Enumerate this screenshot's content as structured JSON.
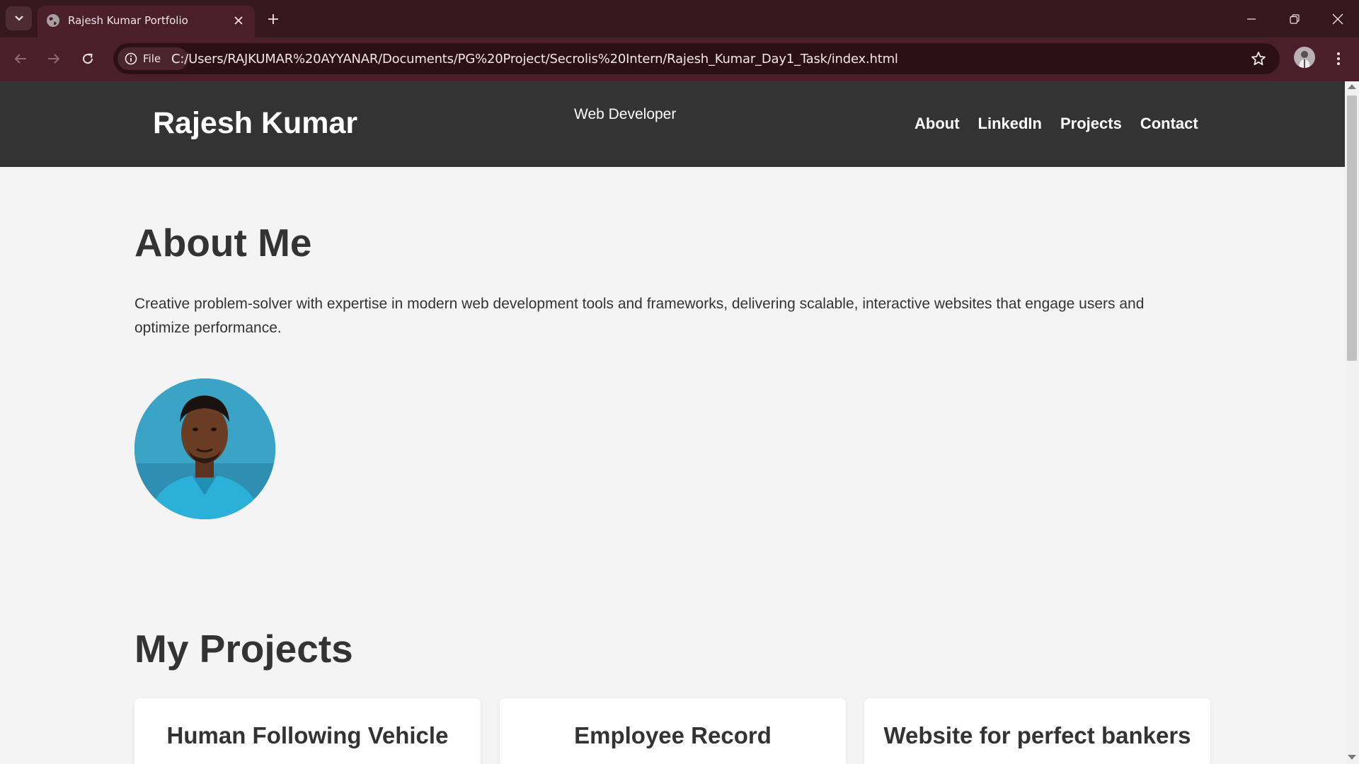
{
  "browser": {
    "tab": {
      "title": "Rajesh Kumar Portfolio"
    },
    "site_chip_label": "File",
    "url": "C:/Users/RAJKUMAR%20AYYANAR/Documents/PG%20Project/Secrolis%20Intern/Rajesh_Kumar_Day1_Task/index.html",
    "icons": [
      "tab-list-icon",
      "globe-icon",
      "close-icon",
      "plus-icon",
      "minimize-icon",
      "restore-icon",
      "window-close-icon",
      "back-arrow-icon",
      "forward-arrow-icon",
      "reload-icon",
      "info-icon",
      "star-icon",
      "profile-avatar",
      "kebab-menu-icon"
    ]
  },
  "header": {
    "name": "Rajesh Kumar",
    "role": "Web Developer",
    "nav": [
      "About",
      "LinkedIn",
      "Projects",
      "Contact"
    ]
  },
  "about": {
    "title": "About Me",
    "text": "Creative problem-solver with expertise in modern web development tools and frameworks, delivering scalable, interactive websites that engage users and optimize performance."
  },
  "projects": {
    "title": "My Projects",
    "cards": [
      "Human Following Vehicle",
      "Employee Record",
      "Website for perfect bankers"
    ]
  },
  "colors": {
    "tab_bar": "#35171f",
    "toolbar": "#4a1e2a",
    "site_header": "#333333",
    "page_bg": "#f4f4f4",
    "text": "#333333"
  }
}
